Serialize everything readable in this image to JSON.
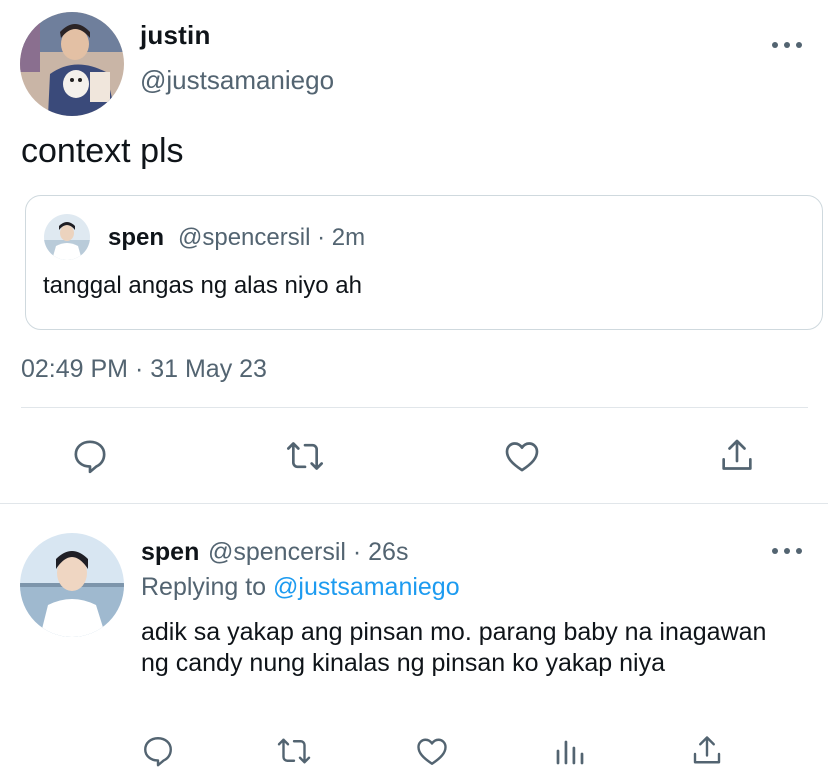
{
  "main_tweet": {
    "display_name": "justin",
    "handle": "@justsamaniego",
    "text": "context pls",
    "timestamp": "02:49 PM · 31 May 23"
  },
  "quoted_tweet": {
    "display_name": "spen",
    "handle_time": "@spencersil · 2m",
    "text": "tanggal angas ng alas niyo ah"
  },
  "reply": {
    "display_name": "spen",
    "handle_time": "@spencersil · 26s",
    "replying_to_prefix": "Replying to",
    "replying_to_handle": "@justsamaniego",
    "text": "adik sa yakap ang pinsan mo. parang baby na inagawan ng candy nung kinalas ng pinsan ko yakap niya"
  },
  "icons": {
    "main_actions": [
      "reply-icon",
      "retweet-icon",
      "like-icon",
      "share-icon"
    ],
    "reply_actions": [
      "reply-icon",
      "retweet-icon",
      "like-icon",
      "views-icon",
      "share-icon"
    ],
    "more": "more-icon"
  },
  "colors": {
    "text": "#0f1419",
    "secondary": "#536471",
    "link": "#1d9bf0",
    "border": "#cfd9de"
  }
}
